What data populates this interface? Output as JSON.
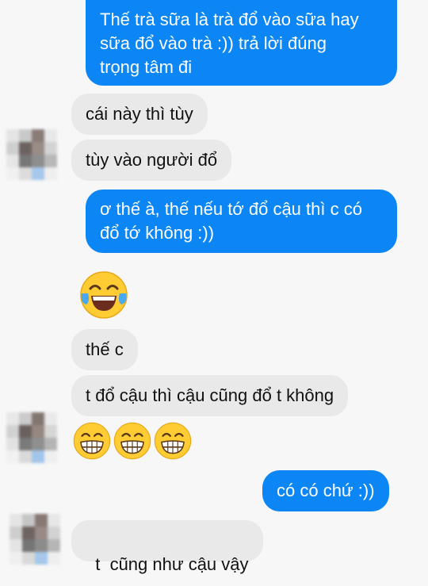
{
  "messages": [
    {
      "direction": "outgoing",
      "lines": [
        "Thế trà sữa là trà đổ vào sữa hay",
        "sữa đổ vào trà :)) trả lời đúng",
        "trọng tâm đi"
      ]
    },
    {
      "direction": "incoming",
      "text": "cái này thì tùy"
    },
    {
      "direction": "incoming",
      "text": "tùy vào người đổ"
    },
    {
      "direction": "outgoing",
      "lines": [
        "ơ thế à, thế nếu tớ đổ cậu thì c có",
        "đổ tớ không :))"
      ]
    },
    {
      "direction": "incoming",
      "emoji": [
        "tears-of-joy"
      ]
    },
    {
      "direction": "incoming",
      "text": "thế c"
    },
    {
      "direction": "incoming",
      "text": "t đổ cậu thì cậu cũng đổ t không"
    },
    {
      "direction": "incoming",
      "emoji": [
        "grinning",
        "grinning",
        "grinning"
      ]
    },
    {
      "direction": "outgoing",
      "text": "có có chứ :))"
    },
    {
      "direction": "incoming",
      "text": "t  cũng như cậu vậy"
    }
  ],
  "colors": {
    "outgoing_bubble": "#0b86f4",
    "incoming_bubble": "#e9e9e9",
    "background": "#f7f7f7",
    "emoji_face": "#ffcc33"
  }
}
